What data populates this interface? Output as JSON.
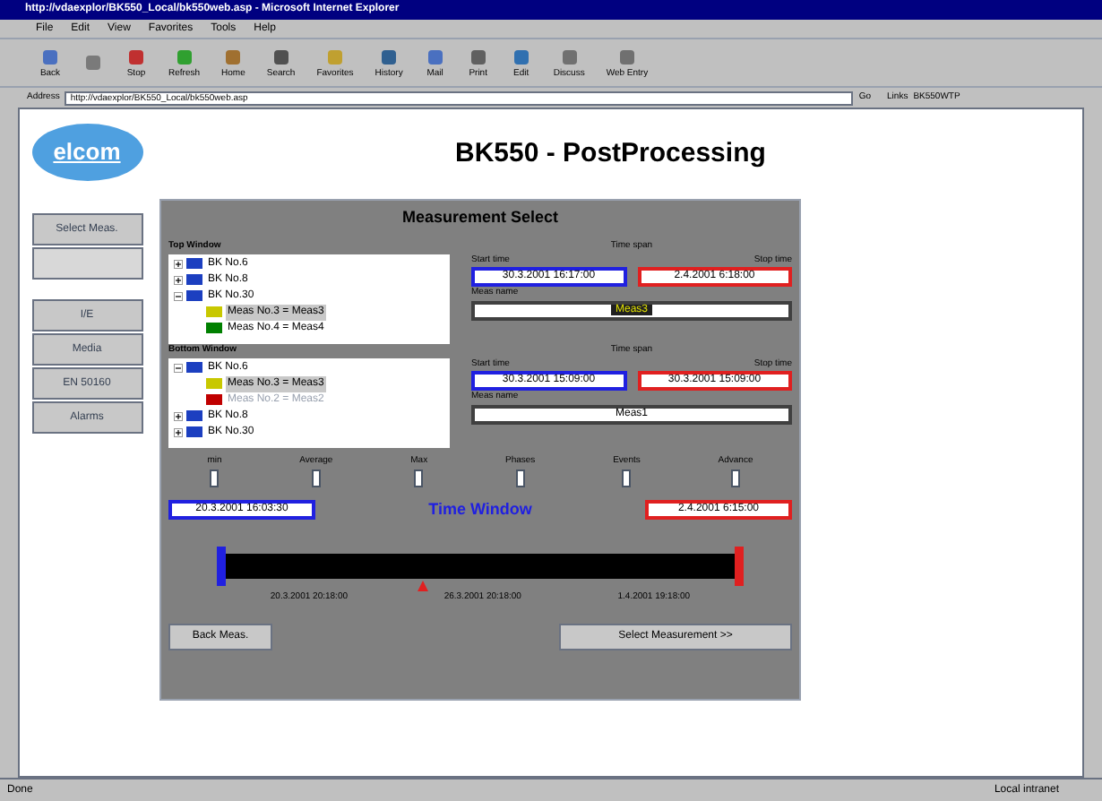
{
  "window": {
    "title": "http://vdaexplor/BK550_Local/bk550web.asp - Microsoft Internet Explorer"
  },
  "menu": [
    "File",
    "Edit",
    "View",
    "Favorites",
    "Tools",
    "Help"
  ],
  "toolbar": [
    {
      "kind": "labeled",
      "label": "Back"
    },
    {
      "kind": "icon"
    },
    {
      "kind": "labeled",
      "label": "Stop"
    },
    {
      "kind": "labeled",
      "label": "Refresh"
    },
    {
      "kind": "labeled",
      "label": "Home"
    },
    {
      "kind": "labeled",
      "label": "Search"
    },
    {
      "kind": "labeled",
      "label": "Favorites"
    },
    {
      "kind": "labeled",
      "label": "History"
    },
    {
      "kind": "labeled",
      "label": "Mail"
    },
    {
      "kind": "labeled",
      "label": "Print"
    },
    {
      "kind": "labeled",
      "label": "Edit"
    },
    {
      "kind": "labeled",
      "label": "Discuss"
    },
    {
      "kind": "labeled",
      "label": "Web Entry"
    }
  ],
  "address": {
    "label": "Address",
    "value": "http://vdaexplor/BK550_Local/bk550web.asp",
    "go": "Go",
    "links": "Links",
    "link": "BK550WTP"
  },
  "page": {
    "logo": "elcom",
    "title": "BK550 - PostProcessing"
  },
  "nav": [
    {
      "label": "Select Meas.",
      "disabled": false
    },
    {
      "disabled": true
    },
    {
      "label": "I/E",
      "disabled": false
    },
    {
      "label": "Media",
      "disabled": false
    },
    {
      "label": "EN 50160",
      "disabled": false
    },
    {
      "label": "Alarms",
      "disabled": false
    }
  ],
  "panel": {
    "title": "Measurement Select",
    "windows": [
      {
        "label": "Top Window",
        "tree": [
          {
            "label": "BK No.6",
            "kind": "device",
            "expanded": false
          },
          {
            "label": "BK No.8",
            "kind": "device",
            "expanded": false
          },
          {
            "label": "BK No.30",
            "kind": "device",
            "expanded": true,
            "children": [
              {
                "label": "Meas No.3 = Meas3",
                "kind": "meas",
                "color": "#c8c800",
                "selected": true,
                "disabled": false
              },
              {
                "label": "Meas No.4 = Meas4",
                "kind": "meas",
                "color": "#008000",
                "selected": false,
                "disabled": false
              }
            ]
          }
        ],
        "span": {
          "label": "Time span",
          "start_label": "Start time",
          "start": "30.3.2001 16:17:00",
          "stop_label": "Stop time",
          "stop": "2.4.2001 6:18:00",
          "name_label": "Meas name",
          "name": "Meas3",
          "name_selected": true
        }
      },
      {
        "label": "Bottom Window",
        "tree": [
          {
            "label": "BK No.6",
            "kind": "device",
            "expanded": true,
            "children": [
              {
                "label": "Meas No.3 = Meas3",
                "kind": "meas",
                "color": "#c8c800",
                "selected": true,
                "disabled": false
              },
              {
                "label": "Meas No.2 = Meas2",
                "kind": "meas",
                "color": "#c00000",
                "selected": false,
                "disabled": true
              }
            ]
          },
          {
            "label": "BK No.8",
            "kind": "device",
            "expanded": false
          },
          {
            "label": "BK No.30",
            "kind": "device",
            "expanded": false
          }
        ],
        "span": {
          "label": "Time span",
          "start_label": "Start time",
          "start": "30.3.2001 15:09:00",
          "stop_label": "Stop time",
          "stop": "30.3.2001 15:09:00",
          "name_label": "Meas name",
          "name": "Meas1",
          "name_selected": false
        }
      }
    ],
    "spinners": [
      "min",
      "Average",
      "Max",
      "Phases",
      "Events",
      "Advance"
    ],
    "time_window": {
      "title": "Time Window",
      "start": "20.3.2001 16:03:30",
      "stop": "2.4.2001 6:15:00",
      "marker": {
        "level": 0.38
      },
      "ticks": [
        "20.3.2001 20:18:00",
        "26.3.2001 20:18:00",
        "1.4.2001 19:18:00"
      ]
    },
    "buttons": [
      "Back Meas.",
      "Select Measurement >>"
    ]
  },
  "status_bar": {
    "text": "Done",
    "zone": "Local intranet"
  }
}
